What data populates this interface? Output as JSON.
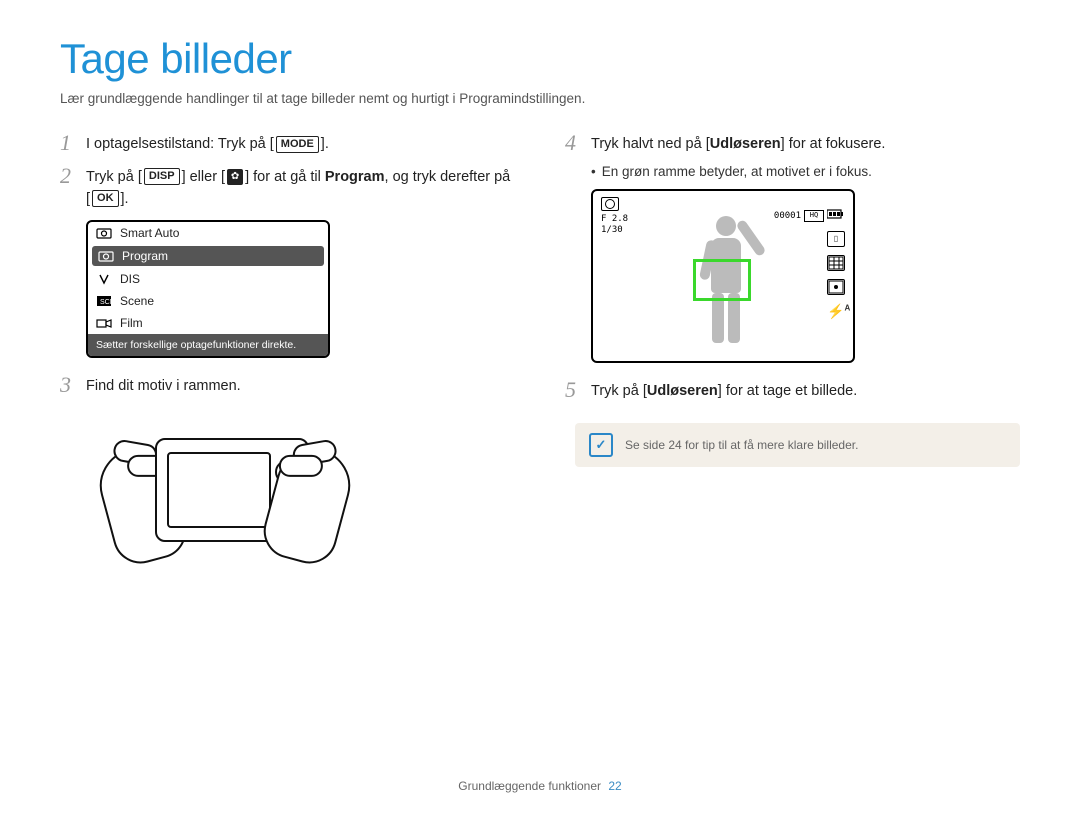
{
  "title": "Tage billeder",
  "subtitle": "Lær grundlæggende handlinger til at tage billeder nemt og hurtigt i Programindstillingen.",
  "steps": {
    "s1": {
      "num": "1",
      "pre": "I optagelsestilstand: Tryk på [",
      "btn": "MODE",
      "post": "]."
    },
    "s2": {
      "num": "2",
      "pre": "Tryk på [",
      "btn1": "DISP",
      "mid1": "] eller [",
      "btn2_icon": "flower-icon",
      "mid2": "] for at gå til ",
      "program": "Program",
      "mid3": ", og tryk derefter på [",
      "btn3": "OK",
      "post": "]."
    },
    "s3": {
      "num": "3",
      "text": "Find dit motiv i rammen."
    },
    "s4": {
      "num": "4",
      "pre": "Tryk halvt ned på [",
      "bold": "Udløseren",
      "post": "] for at fokusere."
    },
    "s4_bullet": "En grøn ramme betyder, at motivet er i fokus.",
    "s5": {
      "num": "5",
      "pre": "Tryk på [",
      "bold": "Udløseren",
      "post": "] for at tage et billede."
    }
  },
  "mode_menu": {
    "items": [
      {
        "label": "Smart Auto"
      },
      {
        "label": "Program",
        "selected": true
      },
      {
        "label": "DIS"
      },
      {
        "label": "Scene"
      },
      {
        "label": "Film"
      }
    ],
    "caption": "Sætter forskellige optagefunktioner direkte."
  },
  "viewfinder": {
    "counter": "00001",
    "badge1": "HQ",
    "aperture": "F 2.8",
    "shutter": "1/30",
    "flash_label": "A"
  },
  "note": {
    "text": "Se side 24 for tip til at få mere klare billeder."
  },
  "footer": {
    "section": "Grundlæggende funktioner",
    "page": "22"
  }
}
